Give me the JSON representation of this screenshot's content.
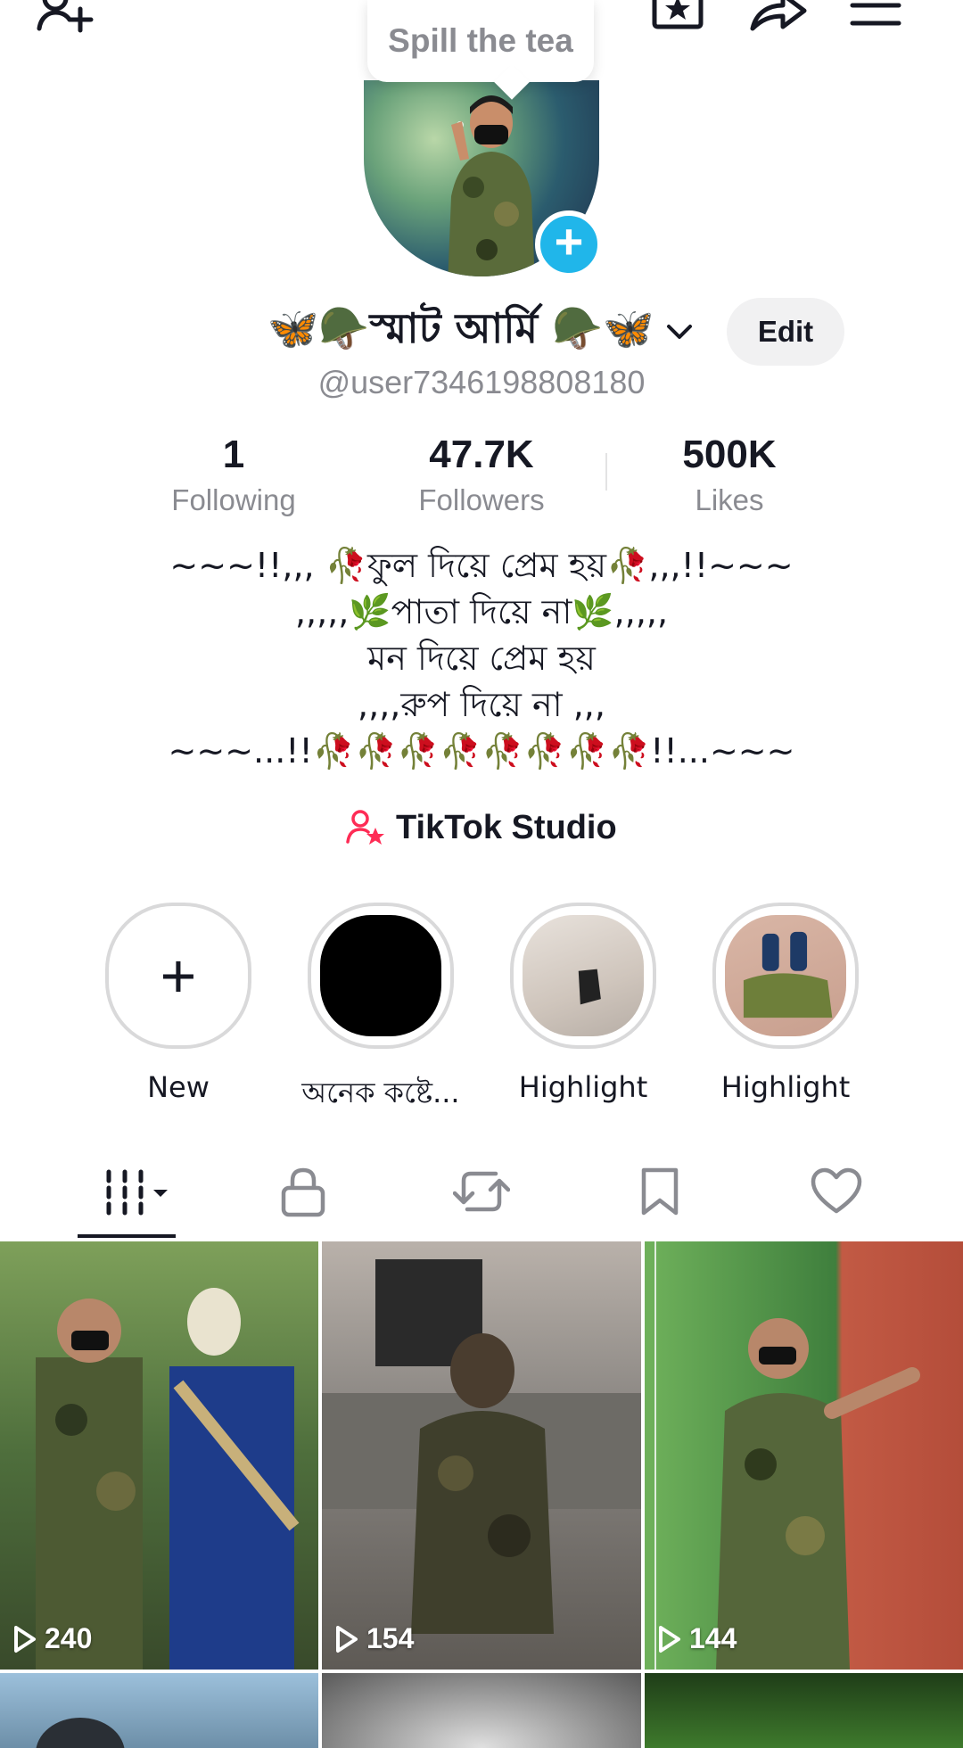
{
  "top_bar": {
    "tooltip": "Spill the tea"
  },
  "profile": {
    "display_name": "🦋🪖স্মাট আর্মি 🪖🦋",
    "username": "@user7346198808180",
    "edit_label": "Edit"
  },
  "stats": [
    {
      "value": "1",
      "label": "Following"
    },
    {
      "value": "47.7K",
      "label": "Followers"
    },
    {
      "value": "500K",
      "label": "Likes"
    }
  ],
  "bio": {
    "line1": "~~~!!,,, 🥀ফুল দিয়ে প্রেম হয়🥀,,,!!~~~",
    "line2": ",,,,,🌿পাতা দিয়ে না🌿,,,,,",
    "line3": "মন দিয়ে প্রেম হয়",
    "line4": ",,,,রুপ দিয়ে না ,,,",
    "line5": "~~~...!!🥀🥀🥀🥀🥀🥀🥀🥀!!...~~~"
  },
  "studio": {
    "label": "TikTok Studio"
  },
  "highlights": [
    {
      "label": "New"
    },
    {
      "label": "অনেক কষ্টে..."
    },
    {
      "label": "Highlight"
    },
    {
      "label": "Highlight"
    }
  ],
  "tabs": [
    "videos",
    "private",
    "reposts",
    "favorites",
    "liked"
  ],
  "videos": [
    {
      "views": "240"
    },
    {
      "views": "154"
    },
    {
      "views": "144"
    }
  ],
  "colors": {
    "accent_blue": "#20b6ea",
    "studio_pink": "#fe2c55",
    "text_primary": "#161823",
    "text_secondary": "#8a8b91"
  }
}
